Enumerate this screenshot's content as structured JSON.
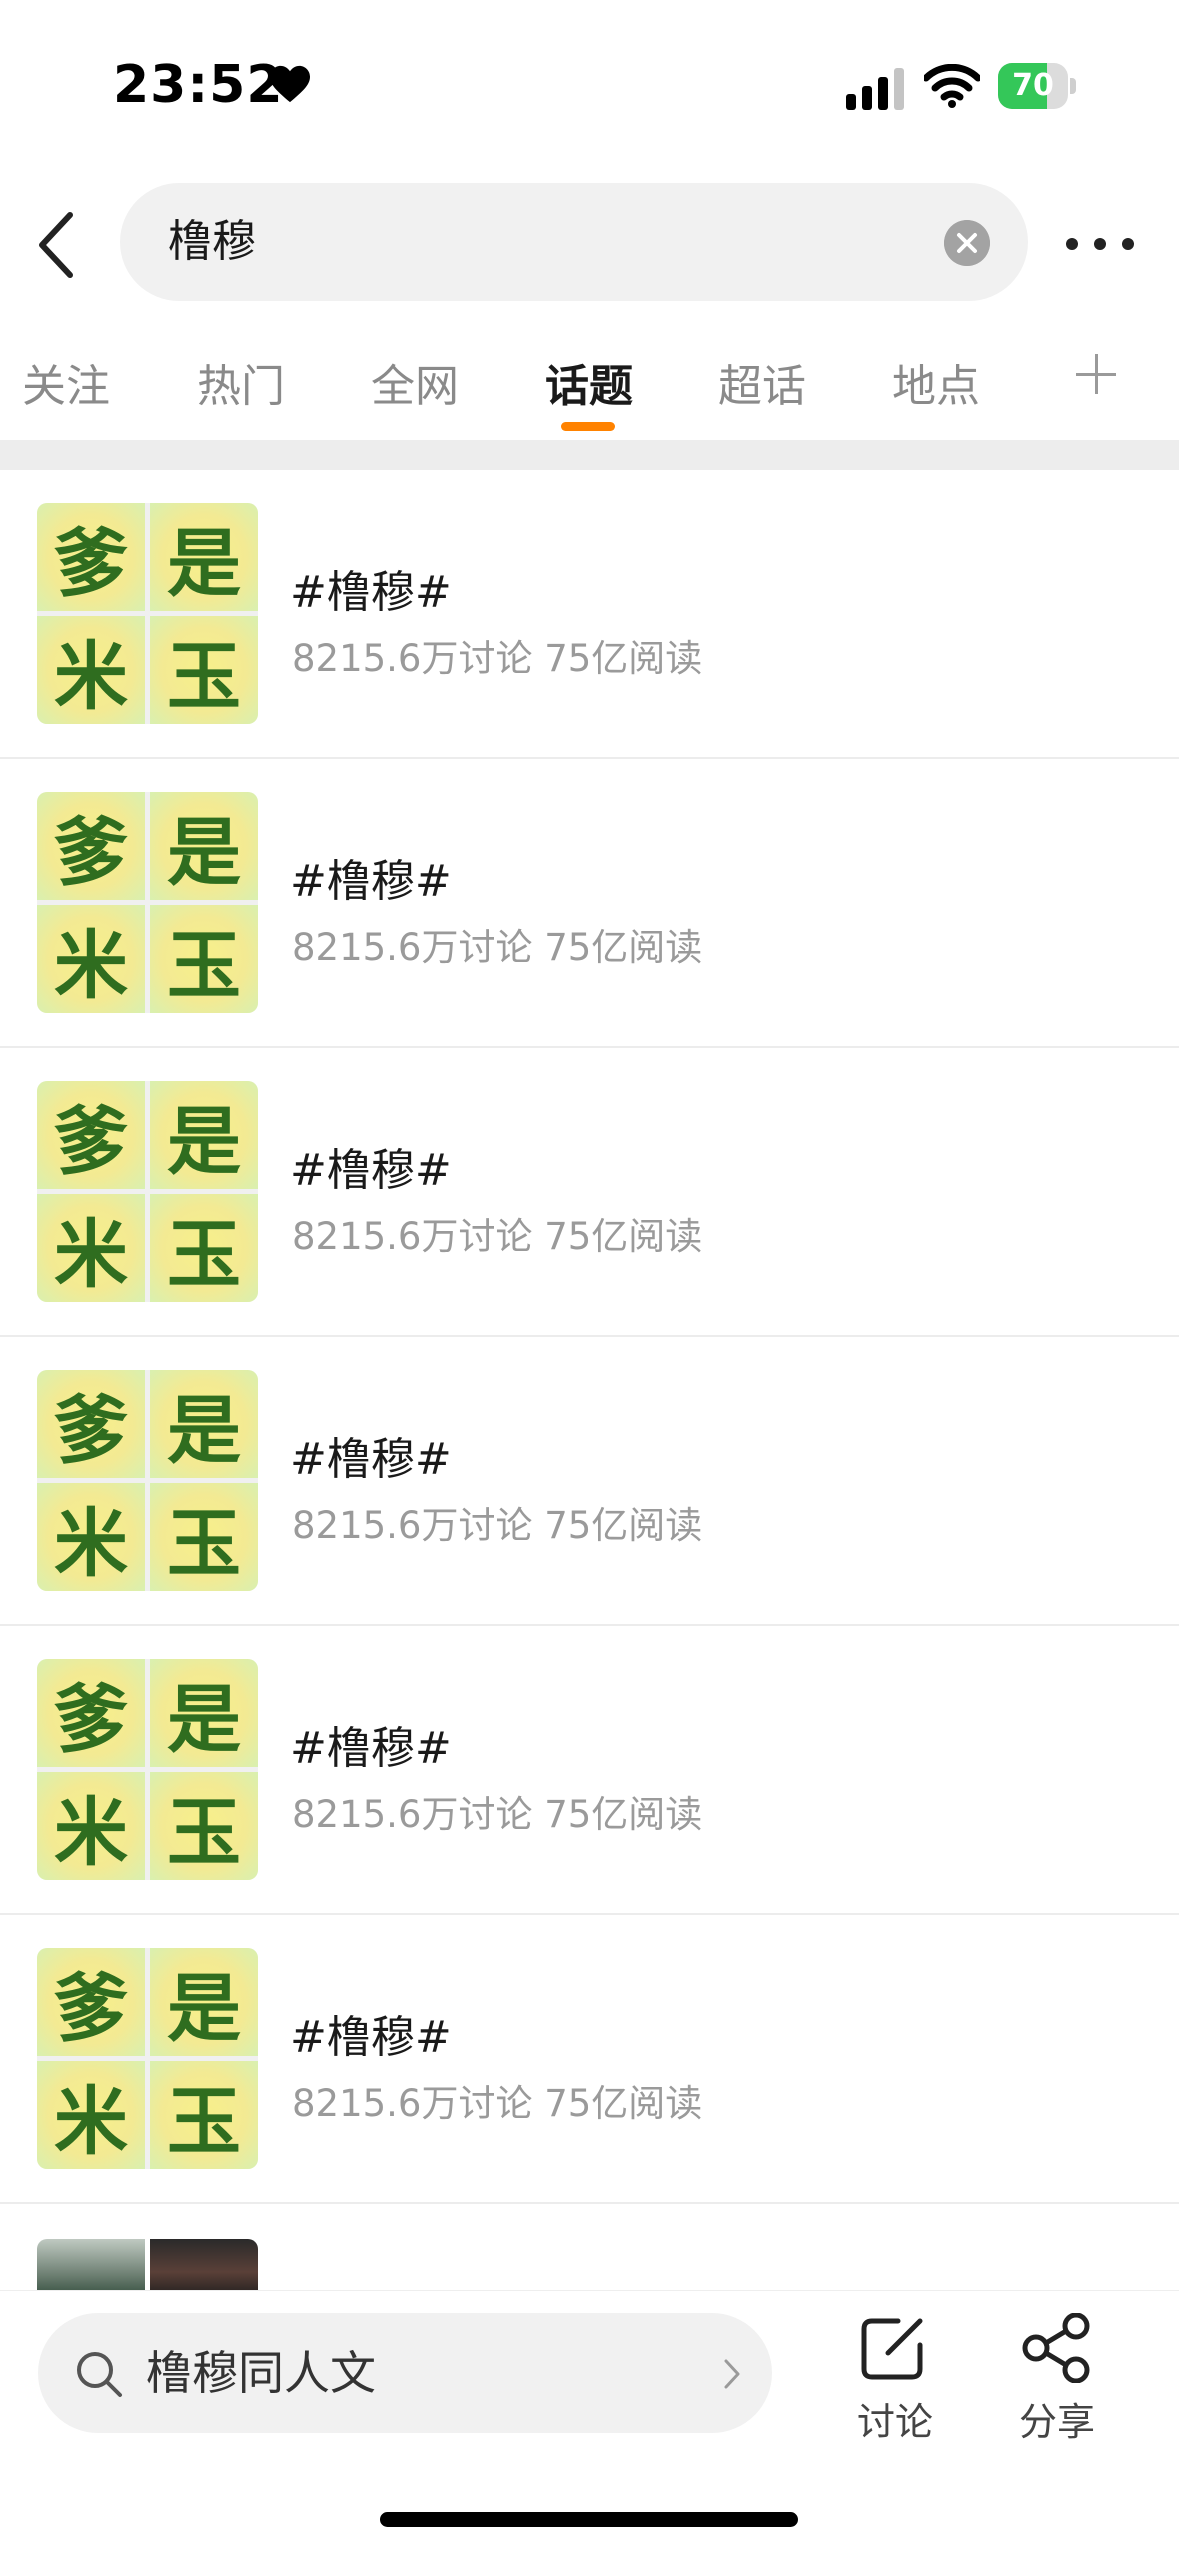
{
  "status_bar": {
    "time": "23:52",
    "battery": "70",
    "battery_level": 0.7
  },
  "search": {
    "query": "橹穆"
  },
  "tabs": [
    {
      "label": "关注",
      "active": false
    },
    {
      "label": "热门",
      "active": false
    },
    {
      "label": "全网",
      "active": false
    },
    {
      "label": "话题",
      "active": true
    },
    {
      "label": "超话",
      "active": false
    },
    {
      "label": "地点",
      "active": false
    }
  ],
  "thumbnail_chars": [
    "爹",
    "是",
    "米",
    "玉"
  ],
  "topics": [
    {
      "title": "#橹穆#",
      "meta": "8215.6万讨论 75亿阅读"
    },
    {
      "title": "#橹穆#",
      "meta": "8215.6万讨论 75亿阅读"
    },
    {
      "title": "#橹穆#",
      "meta": "8215.6万讨论 75亿阅读"
    },
    {
      "title": "#橹穆#",
      "meta": "8215.6万讨论 75亿阅读"
    },
    {
      "title": "#橹穆#",
      "meta": "8215.6万讨论 75亿阅读"
    },
    {
      "title": "#橹穆#",
      "meta": "8215.6万讨论 75亿阅读"
    }
  ],
  "bottom_bar": {
    "search_text": "橹穆同人文",
    "discuss_label": "讨论",
    "share_label": "分享"
  },
  "colors": {
    "accent": "#ff8200",
    "thumb_text": "#2f6d1f",
    "battery_green": "#34c759"
  }
}
